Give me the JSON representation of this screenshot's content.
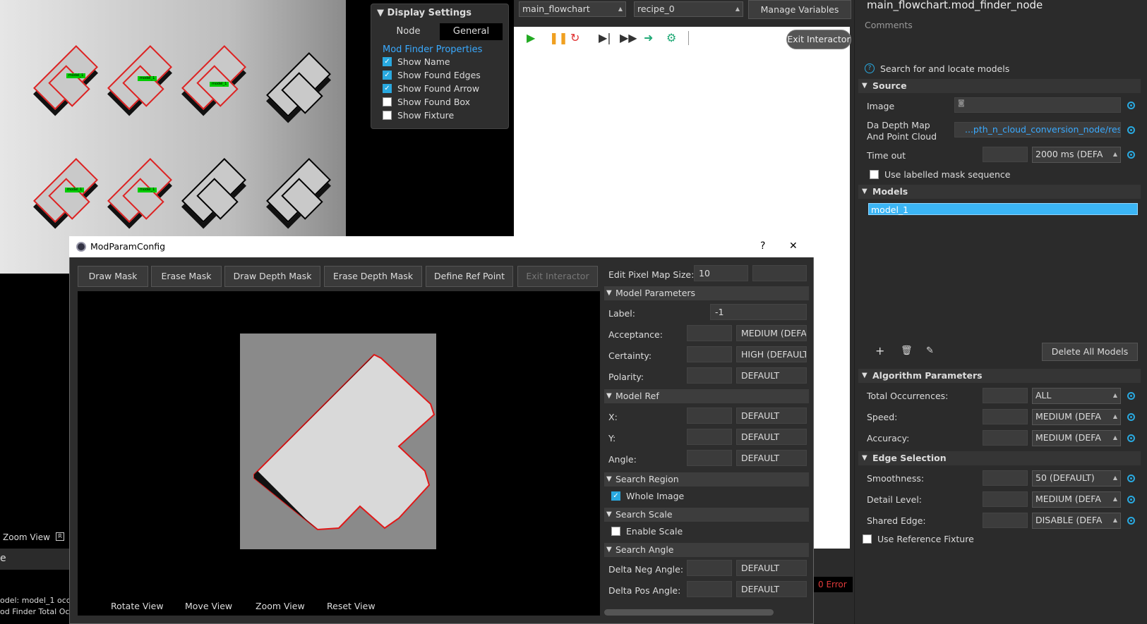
{
  "viewer": {
    "labels": [
      "model_1",
      "model_1",
      "model_1",
      "model_1",
      "model_1"
    ],
    "zoom_view": "Zoom View",
    "zoom_key": "R"
  },
  "display_settings": {
    "title": "Display Settings",
    "tabs": [
      "Node",
      "General"
    ],
    "active_tab": "General",
    "section": "Mod Finder Properties",
    "options": [
      {
        "label": "Show Name",
        "checked": true
      },
      {
        "label": "Show Found Edges",
        "checked": true
      },
      {
        "label": "Show Found Arrow",
        "checked": true
      },
      {
        "label": "Show Found Box",
        "checked": false
      },
      {
        "label": "Show Fixture",
        "checked": false
      }
    ]
  },
  "flowchart": {
    "flow_select": "main_flowchart",
    "recipe_select": "recipe_0",
    "manage_vars": "Manage Variables",
    "exit_interactor": "Exit Interactor",
    "error_badge": "0 Error"
  },
  "properties": {
    "title": "main_flowchart.mod_finder_node",
    "comments": "Comments",
    "description": "Search for and locate models",
    "source": {
      "header": "Source",
      "image_label": "Image",
      "depth_label_1": "Da Depth Map",
      "depth_label_2": "And Point Cloud",
      "depth_value": "...pth_n_cloud_conversion_node/result",
      "timeout_label": "Time out",
      "timeout_value": "2000 ms (DEFA",
      "mask_seq": "Use labelled mask sequence"
    },
    "models": {
      "header": "Models",
      "items": [
        "model_1"
      ],
      "delete_all": "Delete All Models"
    },
    "algorithm": {
      "header": "Algorithm Parameters",
      "rows": [
        {
          "label": "Total Occurrences:",
          "value": "ALL"
        },
        {
          "label": "Speed:",
          "value": "MEDIUM (DEFA"
        },
        {
          "label": "Accuracy:",
          "value": "MEDIUM (DEFA"
        }
      ]
    },
    "edge": {
      "header": "Edge Selection",
      "rows": [
        {
          "label": "Smoothness:",
          "value": "50 (DEFAULT)"
        },
        {
          "label": "Detail Level:",
          "value": "MEDIUM (DEFA"
        },
        {
          "label": "Shared Edge:",
          "value": "DISABLE (DEFA"
        }
      ]
    },
    "ref_fixture": "Use Reference Fixture"
  },
  "dialog": {
    "title": "ModParamConfig",
    "help": "?",
    "close": "✕",
    "buttons": [
      "Draw Mask",
      "Erase Mask",
      "Draw Depth Mask",
      "Erase Depth Mask",
      "Define Ref Point",
      "Exit Interactor"
    ],
    "pixel_map_label": "Edit Pixel Map Size:",
    "pixel_map_value": "10",
    "model_params": {
      "header": "Model Parameters",
      "label_label": "Label:",
      "label_value": "-1",
      "rows": [
        {
          "label": "Acceptance:",
          "value": "MEDIUM (DEFA"
        },
        {
          "label": "Certainty:",
          "value": "HIGH (DEFAULT"
        },
        {
          "label": "Polarity:",
          "value": "DEFAULT"
        }
      ]
    },
    "model_ref": {
      "header": "Model Ref",
      "rows": [
        {
          "label": "X:",
          "value": "DEFAULT"
        },
        {
          "label": "Y:",
          "value": "DEFAULT"
        },
        {
          "label": "Angle:",
          "value": "DEFAULT"
        }
      ]
    },
    "search_region": {
      "header": "Search Region",
      "whole_image": "Whole Image"
    },
    "search_scale": {
      "header": "Search Scale",
      "enable_scale": "Enable Scale"
    },
    "search_angle": {
      "header": "Search Angle",
      "rows": [
        {
          "label": "Delta Neg Angle:",
          "value": "DEFAULT"
        },
        {
          "label": "Delta Pos Angle:",
          "value": "DEFAULT"
        }
      ]
    },
    "view_buttons": [
      "Rotate View",
      "Move View",
      "Zoom View",
      "Reset View"
    ]
  },
  "log": {
    "line1": "odel: model_1 occu",
    "line2": "od Finder Total Oc",
    "tab_e": "e"
  },
  "colors": {
    "accent": "#29a9e0",
    "selection": "#3bb5f5",
    "error": "#e23b3b"
  }
}
